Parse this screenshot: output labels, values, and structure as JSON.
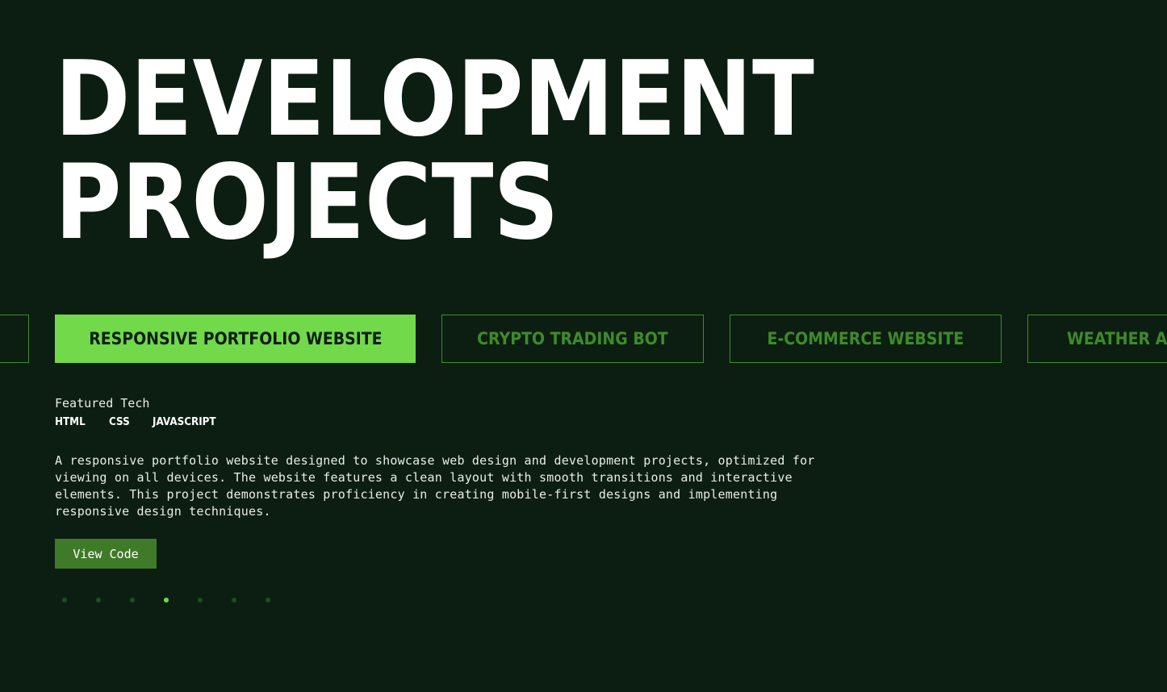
{
  "hero": {
    "title_line1": "DEVELOPMENT",
    "title_line2": "PROJECTS"
  },
  "project_tabs": [
    {
      "label": "",
      "active": false
    },
    {
      "label": "RESPONSIVE PORTFOLIO WEBSITE",
      "active": true
    },
    {
      "label": "CRYPTO TRADING BOT",
      "active": false
    },
    {
      "label": "E-COMMERCE WEBSITE",
      "active": false
    },
    {
      "label": "WEATHER A",
      "active": false
    }
  ],
  "project": {
    "featured_label": "Featured Tech",
    "tech": [
      "HTML",
      "CSS",
      "JAVASCRIPT"
    ],
    "description": "A responsive portfolio website designed to showcase web design and development projects, optimized for viewing on all devices. The website features a clean layout with smooth transitions and interactive elements. This project demonstrates proficiency in creating mobile-first designs and implementing responsive design techniques.",
    "view_code_label": "View Code"
  },
  "pagination": {
    "total": 7,
    "active_index": 3
  },
  "colors": {
    "background": "#0c1e12",
    "accent": "#72d94a",
    "tab_outline": "#3f8a2a",
    "button": "#3f7a29",
    "dot_inactive": "#1e4d20"
  }
}
